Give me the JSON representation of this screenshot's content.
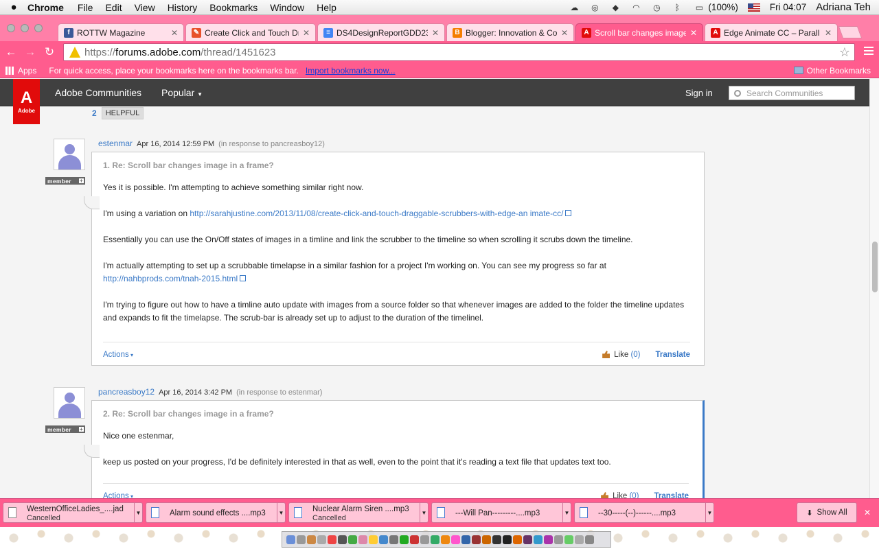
{
  "menubar": {
    "apple": "",
    "app": "Chrome",
    "items": [
      "File",
      "Edit",
      "View",
      "History",
      "Bookmarks",
      "Window",
      "Help"
    ],
    "battery": "(100%)",
    "clock": "Fri 04:07",
    "user": "Adriana Teh"
  },
  "tabs": [
    {
      "title": "ROTTW Magazine",
      "icon": "facebook-icon",
      "color": "#3b5998",
      "glyph": "f"
    },
    {
      "title": "Create Click and Touch Dr",
      "icon": "sarah-justine-icon",
      "color": "#e8502a",
      "glyph": "✎"
    },
    {
      "title": "DS4DesignReportGDD232",
      "icon": "docs-icon",
      "color": "#4285f4",
      "glyph": "≡"
    },
    {
      "title": "Blogger: Innovation & Coll",
      "icon": "blogger-icon",
      "color": "#f57d00",
      "glyph": "B"
    },
    {
      "title": "Scroll bar changes image",
      "icon": "adobe-icon",
      "color": "#e10b0b",
      "glyph": "A"
    },
    {
      "title": "Edge Animate CC – Parall",
      "icon": "adobe-icon",
      "color": "#e10b0b",
      "glyph": "A"
    }
  ],
  "toolbar": {
    "url_scheme": "https://",
    "url_host": "forums.adobe.com",
    "url_path": "/thread/1451623"
  },
  "bookmarks": {
    "apps": "Apps",
    "hint": "For quick access, place your bookmarks here on the bookmarks bar.",
    "import": "Import bookmarks now...",
    "other": "Other Bookmarks"
  },
  "header": {
    "logo_text": "Adobe",
    "communities": "Adobe Communities",
    "popular": "Popular",
    "signin": "Sign in",
    "search_placeholder": "Search Communities"
  },
  "helpful": {
    "count": "2",
    "label": "HELPFUL"
  },
  "posts": [
    {
      "author": "estenmar",
      "date": "Apr 16, 2014 12:59 PM",
      "response": "(in response to pancreasboy12)",
      "badge": "member",
      "title": "1. Re: Scroll bar changes image in a frame?",
      "p1": "Yes it is possible. I'm attempting to achieve something similar right now.",
      "p2_pre": "I'm using a variation on ",
      "p2_link": "http://sarahjustine.com/2013/11/08/create-click-and-touch-draggable-scrubbers-with-edge-an imate-cc/",
      "p3": "Essentially you can use the On/Off states of images in a timline and link the scrubber to the timeline so when scrolling it scrubs down the timeline.",
      "p4": "I'm actually attempting to set up a scrubbable timelapse in a similar fashion for a project I'm working on. You can see my progress so far at",
      "p4_link": "http://nahbprods.com/tnah-2015.html",
      "p5a": "I'm trying to figure out how to have a timline auto update with images from a source folder so that whenever images are added to the folder the timeline updates",
      "p5b": "and expands to fit the timelapse. The scrub-bar is already set up to adjust to the duration of the timelinel.",
      "actions": "Actions",
      "like": "Like",
      "like_count": "(0)",
      "translate": "Translate"
    },
    {
      "author": "pancreasboy12",
      "date": "Apr 16, 2014 3:42 PM",
      "response": "(in response to estenmar)",
      "badge": "member",
      "title": "2. Re: Scroll bar changes image in a frame?",
      "p1": "Nice one estenmar,",
      "p2": "keep us posted on your progress, I'd be definitely interested in that as well, even to the point that it's reading a text file that updates text too.",
      "actions": "Actions",
      "like": "Like",
      "like_count": "(0)",
      "translate": "Translate"
    }
  ],
  "downloads": [
    {
      "name": "WesternOfficeLadies_....jad",
      "status": "Cancelled"
    },
    {
      "name": "Alarm sound effects ....mp3",
      "status": ""
    },
    {
      "name": "Nuclear Alarm Siren ....mp3",
      "status": "Cancelled"
    },
    {
      "name": "---Will Pan---------....mp3",
      "status": ""
    },
    {
      "name": "--30-----(--)------....mp3",
      "status": ""
    }
  ],
  "show_all": "Show All",
  "accent": "#ff5c8e",
  "link_color": "#3b7ac7",
  "adobe_red": "#e10b0b"
}
